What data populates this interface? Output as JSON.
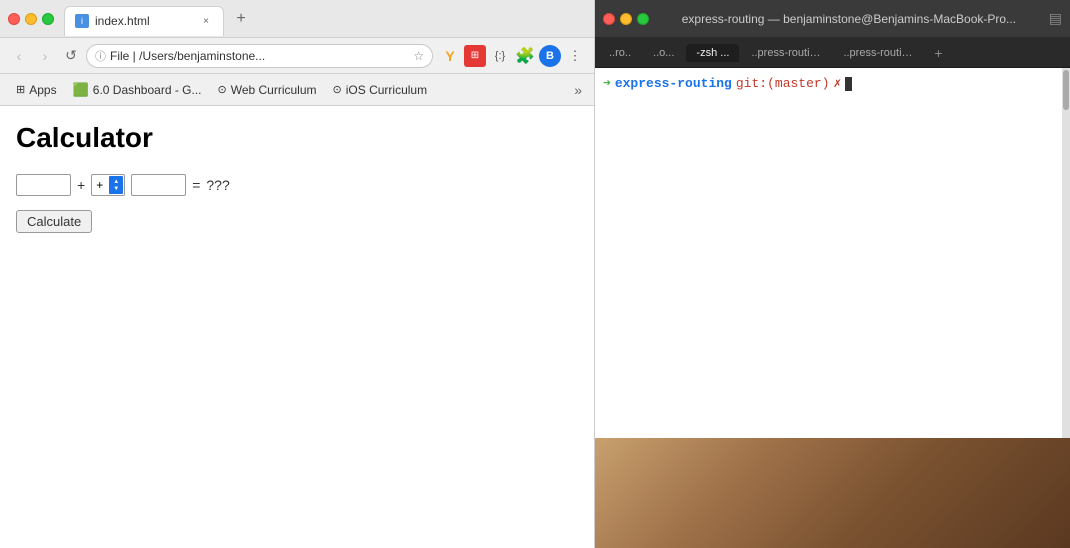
{
  "browser": {
    "tab": {
      "favicon_label": "i",
      "title": "index.html",
      "close_label": "×"
    },
    "new_tab_label": "+",
    "nav": {
      "back_label": "‹",
      "forward_label": "›",
      "reload_label": "↺"
    },
    "address": {
      "info_label": "ⓘ",
      "url": "File | /Users/benjaminstone...",
      "star_label": "☆"
    },
    "toolbar": {
      "extensions_label": "Y",
      "puzzle_label": "⊞",
      "curly_label": "{:}",
      "avatar_label": "B",
      "more_label": "⋮"
    },
    "bookmarks": [
      {
        "icon": "⊞",
        "label": "Apps"
      },
      {
        "icon": "🟩",
        "label": "6.0 Dashboard - G..."
      },
      {
        "icon": "⊙",
        "label": "Web Curriculum"
      },
      {
        "icon": "⊙",
        "label": "iOS Curriculum"
      }
    ],
    "bookmarks_overflow": "»",
    "page": {
      "title": "Calculator",
      "operator": "+",
      "equals": "=",
      "result": "???",
      "button_label": "Calculate",
      "select_option": "+"
    }
  },
  "terminal": {
    "title": "express-routing — benjaminstone@Benjamins-MacBook-Pro...",
    "tabs": [
      {
        "label": "..ro..",
        "active": false
      },
      {
        "label": "..o...",
        "active": false
      },
      {
        "label": "-zsh ...",
        "active": true
      },
      {
        "label": "..press-routing",
        "active": false
      },
      {
        "label": "..press-routing",
        "active": false
      }
    ],
    "new_tab_label": "+",
    "grid_label": "▤",
    "prompt": {
      "arrow": "➜",
      "dir": "express-routing",
      "git_label": "git:",
      "branch_open": "(",
      "branch": "master",
      "branch_close": ")",
      "clean": "✗"
    }
  }
}
